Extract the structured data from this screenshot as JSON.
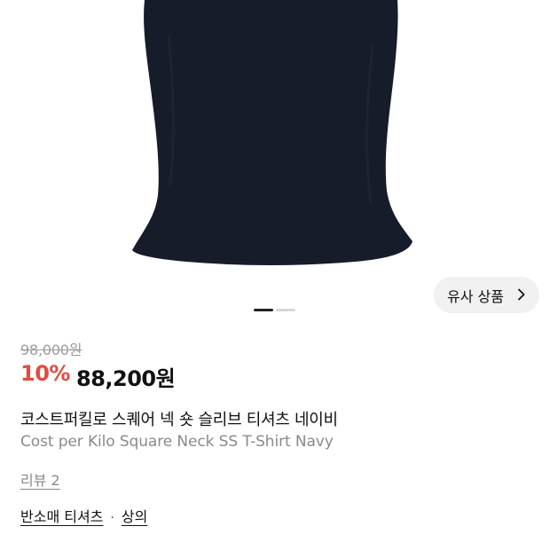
{
  "gallery": {
    "image": "navy-square-neck-top-photo",
    "slide_count": 2,
    "active_slide": 1,
    "similar_button": {
      "label": "유사 상품",
      "icon": "chevron-right-icon"
    }
  },
  "pricing": {
    "original_price": "98,000원",
    "discount": "10%",
    "sale_price": "88,200원",
    "colors": {
      "discount": "#e24c3f",
      "original": "#9c9c9c"
    }
  },
  "product": {
    "name_ko": "코스트퍼킬로 스퀘어 넥 숏 슬리브 티셔츠 네이비",
    "name_en": "Cost per Kilo Square Neck SS T-Shirt Navy"
  },
  "reviews": {
    "label": "리뷰 2"
  },
  "categories": {
    "items": [
      "반소매 티셔츠",
      "상의"
    ],
    "separator": "·"
  }
}
